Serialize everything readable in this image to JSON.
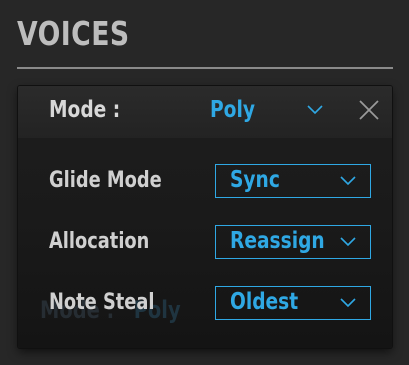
{
  "section": {
    "title": "VOICES"
  },
  "popup": {
    "mode_label": "Mode :",
    "mode_value": "Poly",
    "close_icon": "close-x-icon",
    "chevron_icon": "chevron-down-icon",
    "rows": [
      {
        "label": "Glide Mode",
        "value": "Sync"
      },
      {
        "label": "Allocation",
        "value": "Reassign"
      },
      {
        "label": "Note Steal",
        "value": "Oldest"
      }
    ]
  },
  "background_panel": {
    "mode_label": "Mode :",
    "mode_value": "Poly"
  },
  "colors": {
    "accent": "#2fa8e4",
    "label": "#d0d0d0",
    "title": "#bdbdbd",
    "background": "#272727",
    "panel": "#1a1a1a"
  }
}
